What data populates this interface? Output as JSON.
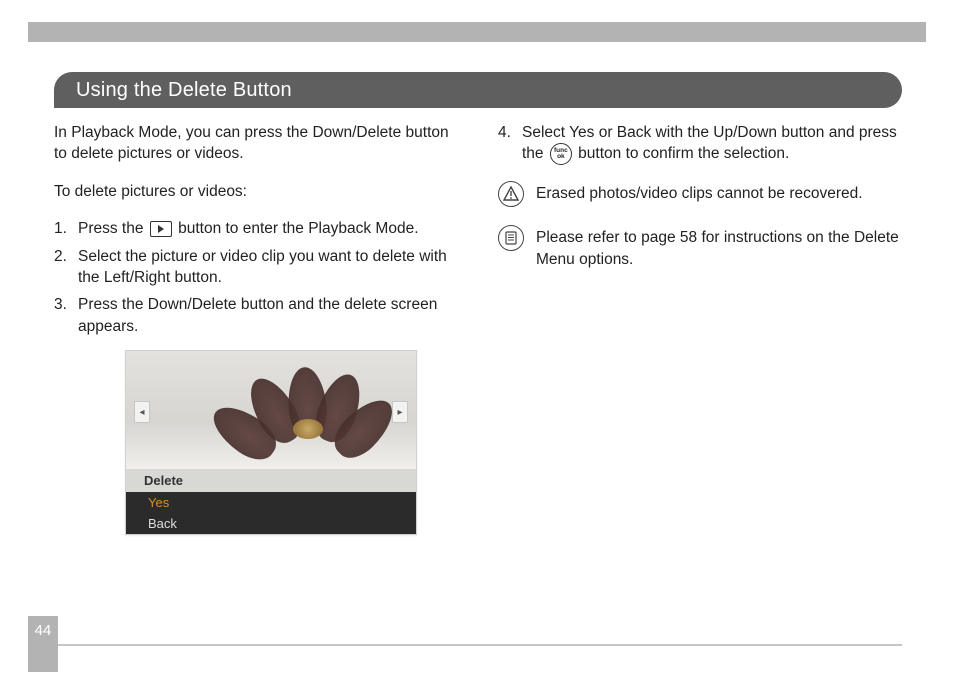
{
  "heading": "Using the Delete Button",
  "page_number": "44",
  "left": {
    "intro": "In Playback Mode, you can press the Down/Delete button to delete pictures or videos.",
    "sub": "To delete pictures or videos:",
    "step1_a": "Press the ",
    "step1_b": " button to enter the Playback Mode.",
    "step2": "Select the picture or video clip you want to delete with the Left/Right button.",
    "step3": "Press the Down/Delete button and the delete screen appears."
  },
  "right": {
    "step4_a": "Select Yes or Back with the Up/Down button and press the ",
    "step4_b": " button to confirm the selection.",
    "warn": "Erased photos/video clips cannot be recovered.",
    "note": "Please refer to page 58 for instructions on the Delete Menu options."
  },
  "func_icon": {
    "top": "func",
    "bottom": "ok"
  },
  "screenshot": {
    "menu_title": "Delete",
    "opt_yes": "Yes",
    "opt_back": "Back",
    "arrow_left": "◂",
    "arrow_right": "▸"
  }
}
